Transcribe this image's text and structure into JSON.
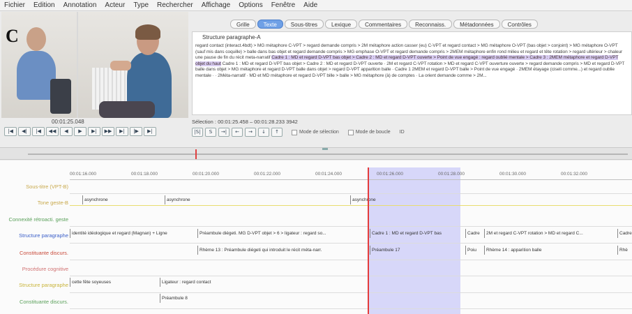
{
  "menu": [
    "Fichier",
    "Edition",
    "Annotation",
    "Acteur",
    "Type",
    "Rechercher",
    "Affichage",
    "Options",
    "Fenêtre",
    "Aide"
  ],
  "panel_letter": "C",
  "video": {
    "timecode": "00:01:25.048"
  },
  "transport_buttons": [
    "|◀",
    "◀|",
    "|◀",
    "◀◀",
    "◀",
    "▶",
    "▶|",
    "▶▶",
    "▶|",
    "|▶",
    "▶|"
  ],
  "tabs": [
    {
      "label": "Grille",
      "active": false
    },
    {
      "label": "Texte",
      "active": true
    },
    {
      "label": "Sous-titres",
      "active": false
    },
    {
      "label": "Lexique",
      "active": false
    },
    {
      "label": "Commentaires",
      "active": false
    },
    {
      "label": "Reconnaiss.",
      "active": false
    },
    {
      "label": "Métadonnées",
      "active": false
    },
    {
      "label": "Contrôles",
      "active": false
    }
  ],
  "text_panel": {
    "tier": "Structure paragraphe-A",
    "before": "regard contact (interact.4bdt) > MG métaphore C-VPT > regard demande compris > 2M métaphore action casser (eu) C-VPT et regard contact > MG métaphore O-VPT (bas objet > conjoint) > MG métaphore O-VPT (sauf mis dans coquille) > balle dans bas objet et regard demande compris > MG emphase O-VPT et regard demande compris > 2MEM métaphore enfin rond milieu et regard et tête rotation > regard ultérieur > chaleur une pause de fin du récit meta-narratif",
    "highlight": "Cadre 1 : MD et regard D-VPT bas objet > Cadre 2 : MD et regard D-VPT ouverte > Point de vue engagé : regard oublié mentale > Cadre 3 : 2MEM métaphore et regard D-VPT objet du haut",
    "after": "Cadre 1 : MD et regard D-VPT bas objet > Cadre 2 : MD et regard D-VPT ouverte · 2M et regard C-VPT rotation > MD et regard C-VPT ouverture ouverte > regard demande compris > MD et regard D-VPT balle dans objet > MG métaphore et regard D-VPT balle dans objet > regard D-VPT apparition balle · Cadre 1 2MEM et regard D-VPT balle > Point de vue engagé · 2MEM étayage (ciseli comme...) et regard oublie mentale · · 2Méta-narratif · MD et MD métaphore et regard D-VPT bille > balle > MG métaphore (à) de comptes · La orient demande comme > 2M..."
  },
  "selection": {
    "info": "Sélection : 00:01:25.458 – 00:01:28.233  3942",
    "mode_selection": "Mode de sélection",
    "mode_boucle": "Mode de boucle",
    "extra": "ID"
  },
  "sel_buttons": [
    "|S|",
    "S",
    "→|",
    "←",
    "→",
    "↓",
    "↑"
  ],
  "ruler_ticks": [
    "00:01:16.000",
    "00:01:18.000",
    "00:01:20.000",
    "00:01:22.000",
    "00:01:24.000",
    "00:01:26.000",
    "00:01:28.000",
    "00:01:30.000",
    "00:01:32.000"
  ],
  "tiers": [
    {
      "label": "Sous-titre (VPT-B)",
      "color": "#c8a84a"
    },
    {
      "label": "Tone geste-B",
      "color": "#c8a84a"
    },
    {
      "label": "Connexité rétroacti. geste",
      "color": "#5aa05a"
    },
    {
      "label": "Structure paragraphe",
      "color": "#3a5ec8"
    },
    {
      "label": "Constituante discurs.",
      "color": "#c84a3a"
    },
    {
      "label": "Procédure cognitive",
      "color": "#d07070"
    },
    {
      "label": "Structure paragraphe",
      "color": "#c8b43a"
    },
    {
      "label": "Constituante discurs.",
      "color": "#5aa05a"
    }
  ],
  "annotations": {
    "tone": [
      "asynchrone",
      "asynchrone",
      "asynchrone"
    ],
    "structure": [
      "identité idéologique et regard (Magnan) + Ligne",
      "Préambule diégeti. MG D-VPT objet > 6 > ligateur : regard so...",
      "Cadre 1 : MD et regard D-VPT bas",
      "Cadre",
      "2M et regard C-VPT rotation > MD et regard C...",
      "Cadre"
    ],
    "constituante": [
      "Rhème 13 : Préambule diégeti qui introduit le récit méta-narr.",
      "Préambule 17",
      "Poiu",
      "Rhème 14 : apparition balle",
      "Rhè"
    ],
    "structure2": [
      "cette fête soyeuses",
      "Ligateur : regard contact"
    ],
    "constituante2": [
      "Préambule 8"
    ]
  }
}
